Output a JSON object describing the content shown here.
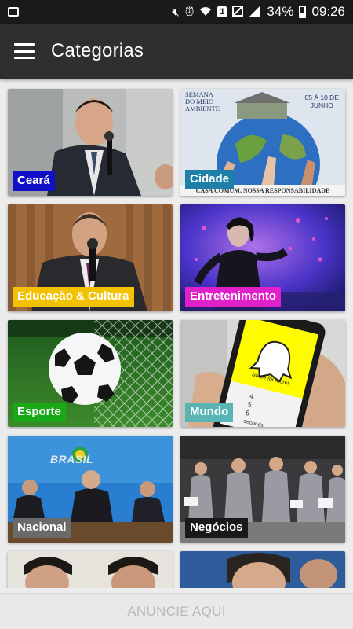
{
  "status_bar": {
    "sim_badge": "1",
    "battery": "34%",
    "time": "09:26"
  },
  "app_bar": {
    "title": "Categorias"
  },
  "categories": [
    {
      "label": "Ceará",
      "color": "#1010c8"
    },
    {
      "label": "Cidade",
      "color": "#1e7fa8"
    },
    {
      "label": "Educação & Cultura",
      "color": "#f2c200"
    },
    {
      "label": "Entretenimento",
      "color": "#e020c8"
    },
    {
      "label": "Esporte",
      "color": "#18a818"
    },
    {
      "label": "Mundo",
      "color": "#5ab4b4"
    },
    {
      "label": "Nacional",
      "color": "#6a6a6a"
    },
    {
      "label": "Negócios",
      "color": "#1a1a1a"
    }
  ],
  "cidade_art": {
    "line1": "SEMANA",
    "line2": "DO MEIO",
    "line3": "AMBIENTE",
    "date_line1": "05 À 10 DE",
    "date_line2": "JUNHO",
    "footer": "CASA COMUM, NOSSA RESPONSABILIDADE"
  },
  "mundo_art": {
    "phone_text": "Swipe for more!",
    "digit_4": "4",
    "digit_5": "5",
    "digit_6": "6",
    "seconds": "seconds"
  },
  "nacional_art": {
    "banner": "BRASIL"
  },
  "ad_bar": {
    "label": "ANUNCIE AQUI"
  }
}
